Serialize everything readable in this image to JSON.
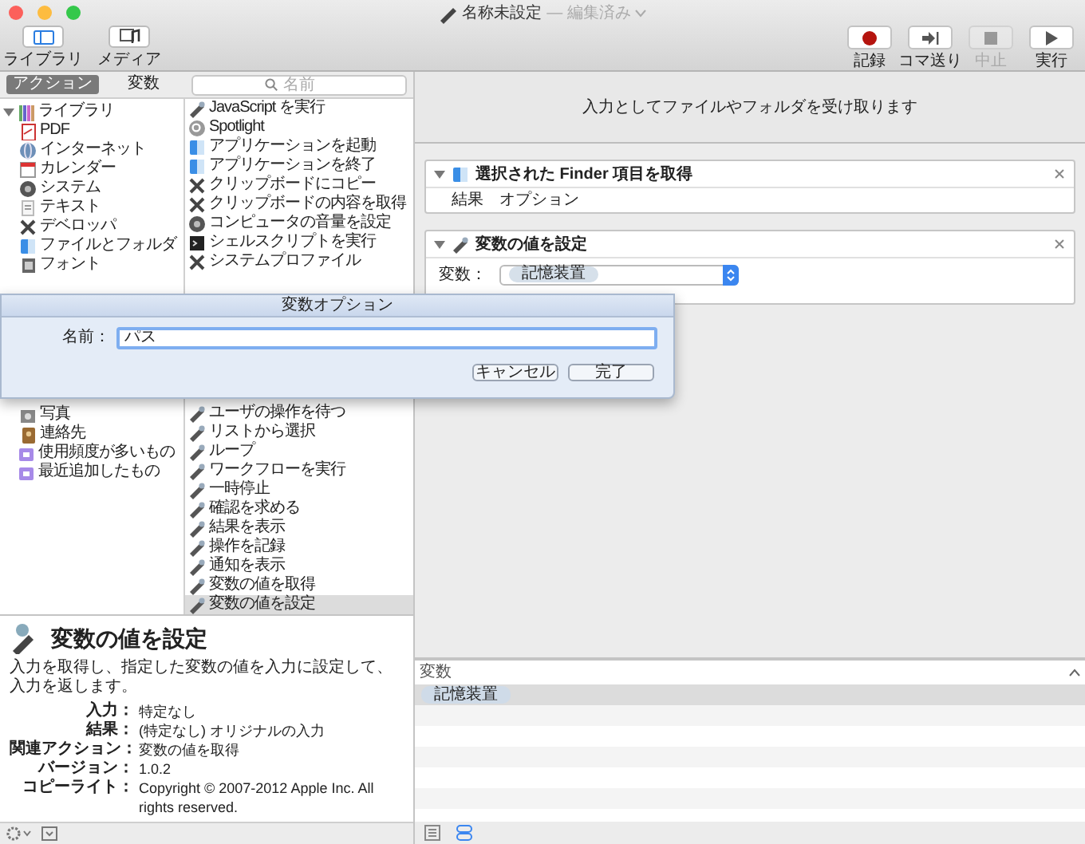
{
  "window": {
    "title": "名称未設定",
    "subtitle": "— 編集済み"
  },
  "toolbar": {
    "left": [
      {
        "label": "ライブラリ",
        "selected": true
      },
      {
        "label": "メディア",
        "selected": false
      }
    ],
    "right": [
      {
        "label": "記録",
        "disabled": false
      },
      {
        "label": "コマ送り",
        "disabled": false
      },
      {
        "label": "中止",
        "disabled": true
      },
      {
        "label": "実行",
        "disabled": false
      }
    ]
  },
  "library_tabs": [
    {
      "label": "アクション",
      "selected": true
    },
    {
      "label": "変数",
      "selected": false
    }
  ],
  "search": {
    "placeholder": "名前"
  },
  "library_tree": [
    {
      "label": "ライブラリ",
      "expanded": true,
      "children": [
        {
          "label": "PDF"
        },
        {
          "label": "インターネット"
        },
        {
          "label": "カレンダー"
        },
        {
          "label": "システム"
        },
        {
          "label": "テキスト"
        },
        {
          "label": "デベロッパ"
        },
        {
          "label": "ファイルとフォルダ"
        },
        {
          "label": "フォント"
        },
        {
          "label": "写真"
        },
        {
          "label": "連絡先"
        }
      ]
    },
    {
      "label": "使用頻度が多いもの"
    },
    {
      "label": "最近追加したもの"
    }
  ],
  "actions": [
    {
      "label": "JavaScript を実行",
      "selected": false
    },
    {
      "label": "Spotlight",
      "selected": false
    },
    {
      "label": "アプリケーションを起動",
      "selected": false
    },
    {
      "label": "アプリケーションを終了",
      "selected": false
    },
    {
      "label": "クリップボードにコピー",
      "selected": false
    },
    {
      "label": "クリップボードの内容を取得",
      "selected": false
    },
    {
      "label": "コンピュータの音量を設定",
      "selected": false
    },
    {
      "label": "シェルスクリプトを実行",
      "selected": false
    },
    {
      "label": "システムプロファイル",
      "selected": false
    },
    {
      "label": "ユーザの操作を待つ",
      "selected": false
    },
    {
      "label": "リストから選択",
      "selected": false
    },
    {
      "label": "ループ",
      "selected": false
    },
    {
      "label": "ワークフローを実行",
      "selected": false
    },
    {
      "label": "一時停止",
      "selected": false
    },
    {
      "label": "確認を求める",
      "selected": false
    },
    {
      "label": "結果を表示",
      "selected": false
    },
    {
      "label": "操作を記録",
      "selected": false
    },
    {
      "label": "通知を表示",
      "selected": false
    },
    {
      "label": "変数の値を取得",
      "selected": false
    },
    {
      "label": "変数の値を設定",
      "selected": true
    }
  ],
  "description": {
    "title": "変数の値を設定",
    "text": "入力を取得し、指定した変数の値を入力に設定して、入力を返します。",
    "fields": [
      {
        "key": "入力：",
        "value": "特定なし"
      },
      {
        "key": "結果：",
        "value": "(特定なし) オリジナルの入力"
      },
      {
        "key": "関連アクション：",
        "value": "変数の値を取得"
      },
      {
        "key": "バージョン：",
        "value": "1.0.2"
      },
      {
        "key": "コピーライト：",
        "value": "Copyright © 2007-2012 Apple Inc.  All rights reserved."
      }
    ]
  },
  "workflow": {
    "input_note": "入力としてファイルやフォルダを受け取ります",
    "steps": [
      {
        "title": "選択された Finder 項目を取得",
        "expanded": true,
        "footer": [
          "結果",
          "オプション"
        ]
      },
      {
        "title": "変数の値を設定",
        "expanded": true,
        "variable_label": "変数：",
        "variable": "記憶装置"
      }
    ]
  },
  "variables_panel": {
    "title": "変数",
    "rows": [
      {
        "name": "記憶装置",
        "selected": true
      }
    ]
  },
  "sheet": {
    "title": "変数オプション",
    "name_label": "名前：",
    "name_value": "パス",
    "buttons": [
      "キャンセル",
      "完了"
    ]
  }
}
